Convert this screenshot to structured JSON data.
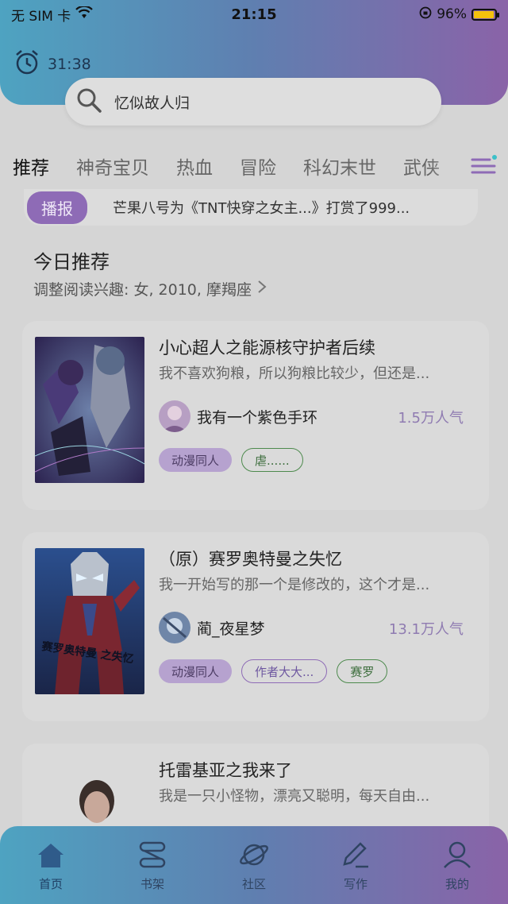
{
  "status_bar": {
    "carrier": "无 SIM 卡",
    "time": "21:15",
    "battery": "96%",
    "battery_level": 0.96
  },
  "timer": {
    "value": "31:38"
  },
  "search": {
    "text": "忆似故人归"
  },
  "tabs": [
    "推荐",
    "神奇宝贝",
    "热血",
    "冒险",
    "科幻末世",
    "武侠"
  ],
  "ticker": {
    "badge": "播报",
    "text": "芒果八号为《TNT快穿之女主...》打赏了999..."
  },
  "section": {
    "title": "今日推荐",
    "subtitle": "调整阅读兴趣: 女, 2010, 摩羯座"
  },
  "books": [
    {
      "title": "小心超人之能源核守护者后续",
      "desc": "我不喜欢狗粮，所以狗粮比较少，但还是...",
      "author": "我有一个紫色手环",
      "popularity": "1.5万人气",
      "tags": [
        {
          "label": "动漫同人",
          "style": "filled"
        },
        {
          "label": "虐......",
          "style": "outline-green"
        }
      ]
    },
    {
      "title": "（原）赛罗奥特曼之失忆",
      "desc": "我一开始写的那一个是修改的，这个才是...",
      "author": "蔺_夜星梦",
      "popularity": "13.1万人气",
      "cover_text": "赛罗奥特曼 之失忆",
      "tags": [
        {
          "label": "动漫同人",
          "style": "filled"
        },
        {
          "label": "作者大大...",
          "style": "outline-purple"
        },
        {
          "label": "赛罗",
          "style": "outline-green"
        }
      ]
    },
    {
      "title": "托雷基亚之我来了",
      "desc": "我是一只小怪物，漂亮又聪明，每天自由..."
    }
  ],
  "nav": [
    {
      "label": "首页",
      "icon": "home-icon"
    },
    {
      "label": "书架",
      "icon": "bookshelf-icon"
    },
    {
      "label": "社区",
      "icon": "planet-icon"
    },
    {
      "label": "写作",
      "icon": "pen-icon"
    },
    {
      "label": "我的",
      "icon": "user-icon"
    }
  ]
}
